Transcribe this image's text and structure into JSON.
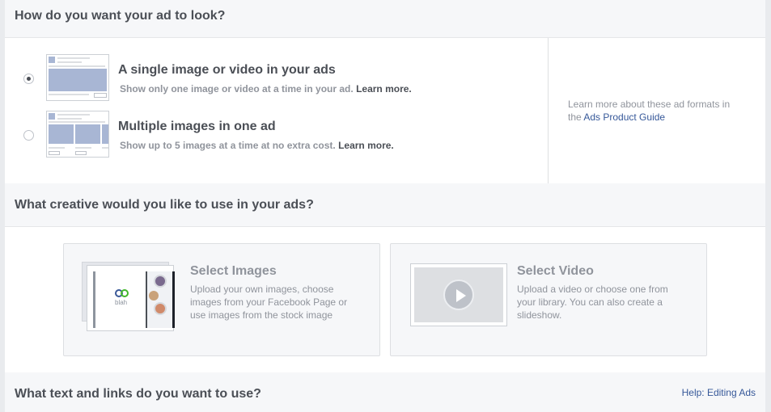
{
  "format_section": {
    "title": "How do you want your ad to look?",
    "options": [
      {
        "title": "A single image or video in your ads",
        "desc": "Show only one image or video at a time in your ad.",
        "link": "Learn more.",
        "selected": true
      },
      {
        "title": "Multiple images in one ad",
        "desc": "Show up to 5 images at a time at no extra cost.",
        "link": "Learn more.",
        "selected": false
      }
    ],
    "side_text": "Learn more about these ad formats in the",
    "side_link": "Ads Product Guide"
  },
  "creative_section": {
    "title": "What creative would you like to use in your ads?",
    "cards": [
      {
        "title": "Select Images",
        "desc": "Upload your own images, choose images from your Facebook Page or use images from the stock image",
        "logo_text": "blah"
      },
      {
        "title": "Select Video",
        "desc": "Upload a video or choose one from your library. You can also create a slideshow."
      }
    ]
  },
  "text_section": {
    "title": "What text and links do you want to use?",
    "help_link": "Help: Editing Ads"
  },
  "colors": {
    "accent_link": "#365899",
    "muted_text": "#90949c",
    "primary_text": "#4b4f56",
    "thumb_fill": "#a8b6d4"
  }
}
